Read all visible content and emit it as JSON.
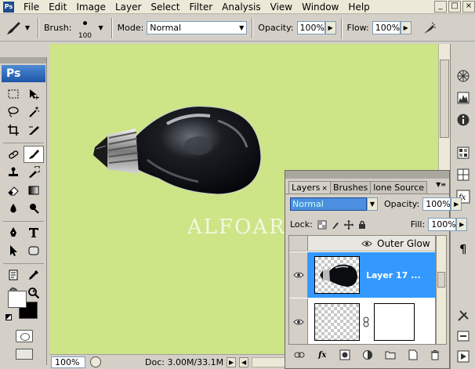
{
  "menu": {
    "items": [
      "File",
      "Edit",
      "Image",
      "Layer",
      "Select",
      "Filter",
      "Analysis",
      "View",
      "Window",
      "Help"
    ],
    "window_controls": [
      "_",
      "□",
      "×"
    ]
  },
  "options_bar": {
    "brush_label": "Brush:",
    "brush_size": "100",
    "mode_label": "Mode:",
    "mode_value": "Normal",
    "opacity_label": "Opacity:",
    "opacity_value": "100%",
    "flow_label": "Flow:",
    "flow_value": "100%"
  },
  "toolbox": {
    "logo": "Ps"
  },
  "canvas": {
    "background": "#cde487",
    "watermark": "ALFOART.COM"
  },
  "status_bar": {
    "zoom": "100%",
    "doc_info": "Doc: 3.00M/33.1M"
  },
  "layers_panel": {
    "tabs": [
      {
        "label": "Layers",
        "close": "×"
      },
      {
        "label": "Brushes",
        "close": ""
      },
      {
        "label": "lone Source",
        "close": ""
      }
    ],
    "blend_mode": "Normal",
    "opacity_label": "Opacity:",
    "opacity_value": "100%",
    "lock_label": "Lock:",
    "fill_label": "Fill:",
    "fill_value": "100%",
    "effect_label": "Outer Glow",
    "active_layer_name": "Layer 17 ...",
    "selection_color": "#3399ff"
  }
}
